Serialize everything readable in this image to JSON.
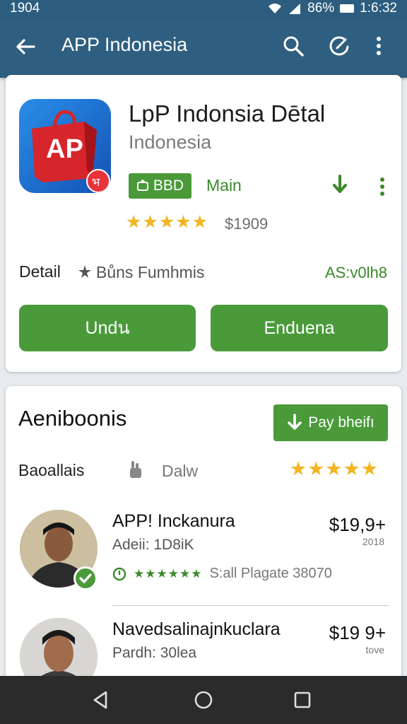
{
  "status": {
    "time_left": "1904",
    "battery": "86%",
    "time_right": "1:6:32"
  },
  "appbar": {
    "title": "APP Indonesia"
  },
  "app": {
    "icon_text": "AP",
    "icon_badge": "भ",
    "name": "LpP Indonsia Dētal",
    "subtitle": "Indonesia",
    "badge_label": "BBD",
    "main_label": "Main",
    "rating_stars": "★★★★★",
    "price": "$1909",
    "detail_label": "Detail",
    "detail_text": "Bůns Fumhmis",
    "detail_right": "AS:v0lh8",
    "button_left": "Undน",
    "button_right": "Enduena"
  },
  "section": {
    "title": "Aeniboonis",
    "play_button": "Pay bheifı",
    "sort_label": "Baoallais",
    "sort_value": "Dalw",
    "rating_stars": "★★★★★"
  },
  "reviews": [
    {
      "name": "APP! Inckanura",
      "sub": "Adeii: 1D8iK",
      "meta_stars": "★★★★★★",
      "meta_text": "S:all Plagate 38070",
      "price": "$19,9+",
      "price_sub": "2018"
    },
    {
      "name": "Navedsalinajnkuclara",
      "sub": "Pardh: 30lea",
      "price": "$19 9+",
      "price_sub": "tove"
    }
  ]
}
